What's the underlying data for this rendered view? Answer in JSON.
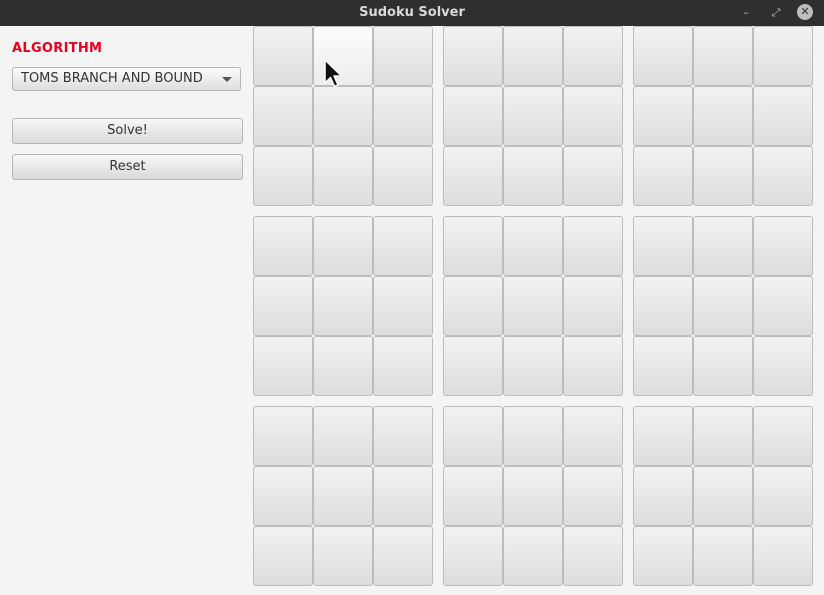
{
  "window": {
    "title": "Sudoku Solver",
    "minimize_glyph": "–",
    "maximize_glyph": "⤢",
    "close_glyph": "✕"
  },
  "sidebar": {
    "algorithm_label": "ALGORITHM",
    "algorithm_selected": "TOMS BRANCH AND BOUND",
    "solve_label": "Solve!",
    "reset_label": "Reset"
  },
  "board": {
    "size": 9,
    "cells": [
      [
        "",
        "",
        "",
        "",
        "",
        "",
        "",
        "",
        ""
      ],
      [
        "",
        "",
        "",
        "",
        "",
        "",
        "",
        "",
        ""
      ],
      [
        "",
        "",
        "",
        "",
        "",
        "",
        "",
        "",
        ""
      ],
      [
        "",
        "",
        "",
        "",
        "",
        "",
        "",
        "",
        ""
      ],
      [
        "",
        "",
        "",
        "",
        "",
        "",
        "",
        "",
        ""
      ],
      [
        "",
        "",
        "",
        "",
        "",
        "",
        "",
        "",
        ""
      ],
      [
        "",
        "",
        "",
        "",
        "",
        "",
        "",
        "",
        ""
      ],
      [
        "",
        "",
        "",
        "",
        "",
        "",
        "",
        "",
        ""
      ],
      [
        "",
        "",
        "",
        "",
        "",
        "",
        "",
        "",
        ""
      ]
    ]
  },
  "colors": {
    "accent_label": "#e8001c",
    "titlebar": "#2f2f2f",
    "window_bg": "#f4f4f4"
  },
  "icons": {
    "window_controls": [
      "minimize-icon",
      "maximize-icon",
      "close-icon"
    ],
    "dropdown": "chevron-down-icon",
    "pointer": "mouse-cursor-icon"
  }
}
